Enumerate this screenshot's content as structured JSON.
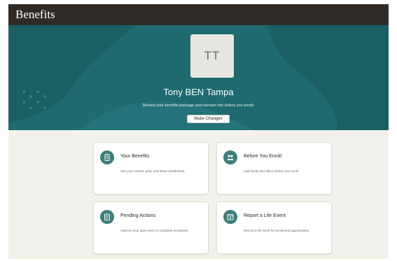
{
  "app": {
    "title": "Benefits"
  },
  "profile": {
    "initials": "TT",
    "name": "Tony BEN Tampa",
    "subtitle": "Review your benefits package and relevant info before you enroll.",
    "action_label": "Make Changes"
  },
  "cards": [
    {
      "title": "Your Benefits",
      "description": "See your current, past, and future enrollments",
      "icon": "benefits-document-icon"
    },
    {
      "title": "Before You Enroll",
      "description": "Add family and others before you enroll",
      "icon": "family-icon"
    },
    {
      "title": "Pending Actions",
      "description": "Address your open items to complete enrollment",
      "icon": "checklist-icon"
    },
    {
      "title": "Report a Life Event",
      "description": "Record a life event for enrollment opportunities",
      "icon": "life-event-icon"
    }
  ],
  "colors": {
    "app_bar": "#302a26",
    "hero": "#1f6a6f",
    "icon_circle": "#3c7e7a",
    "page_background": "#f3f1ec"
  }
}
